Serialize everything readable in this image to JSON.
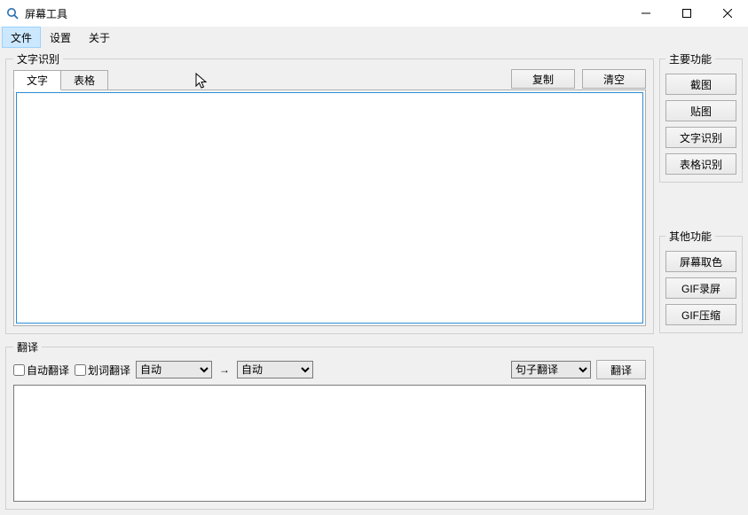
{
  "window": {
    "title": "屏幕工具"
  },
  "menu": {
    "file": "文件",
    "settings": "设置",
    "about": "关于"
  },
  "ocr": {
    "legend": "文字识别",
    "tabs": {
      "text": "文字",
      "table": "表格"
    },
    "buttons": {
      "copy": "复制",
      "clear": "清空"
    },
    "content": ""
  },
  "translate": {
    "legend": "翻译",
    "auto_translate_label": "自动翻译",
    "word_translate_label": "划词翻译",
    "lang_from_options": [
      "自动"
    ],
    "lang_from_selected": "自动",
    "lang_to_options": [
      "自动"
    ],
    "lang_to_selected": "自动",
    "mode_options": [
      "句子翻译"
    ],
    "mode_selected": "句子翻译",
    "button": "翻译",
    "content": ""
  },
  "side": {
    "main_legend": "主要功能",
    "main_buttons": {
      "screenshot": "截图",
      "paste_img": "贴图",
      "ocr_text": "文字识别",
      "ocr_table": "表格识别"
    },
    "other_legend": "其他功能",
    "other_buttons": {
      "color_picker": "屏幕取色",
      "gif_record": "GIF录屏",
      "gif_compress": "GIF压缩"
    }
  }
}
